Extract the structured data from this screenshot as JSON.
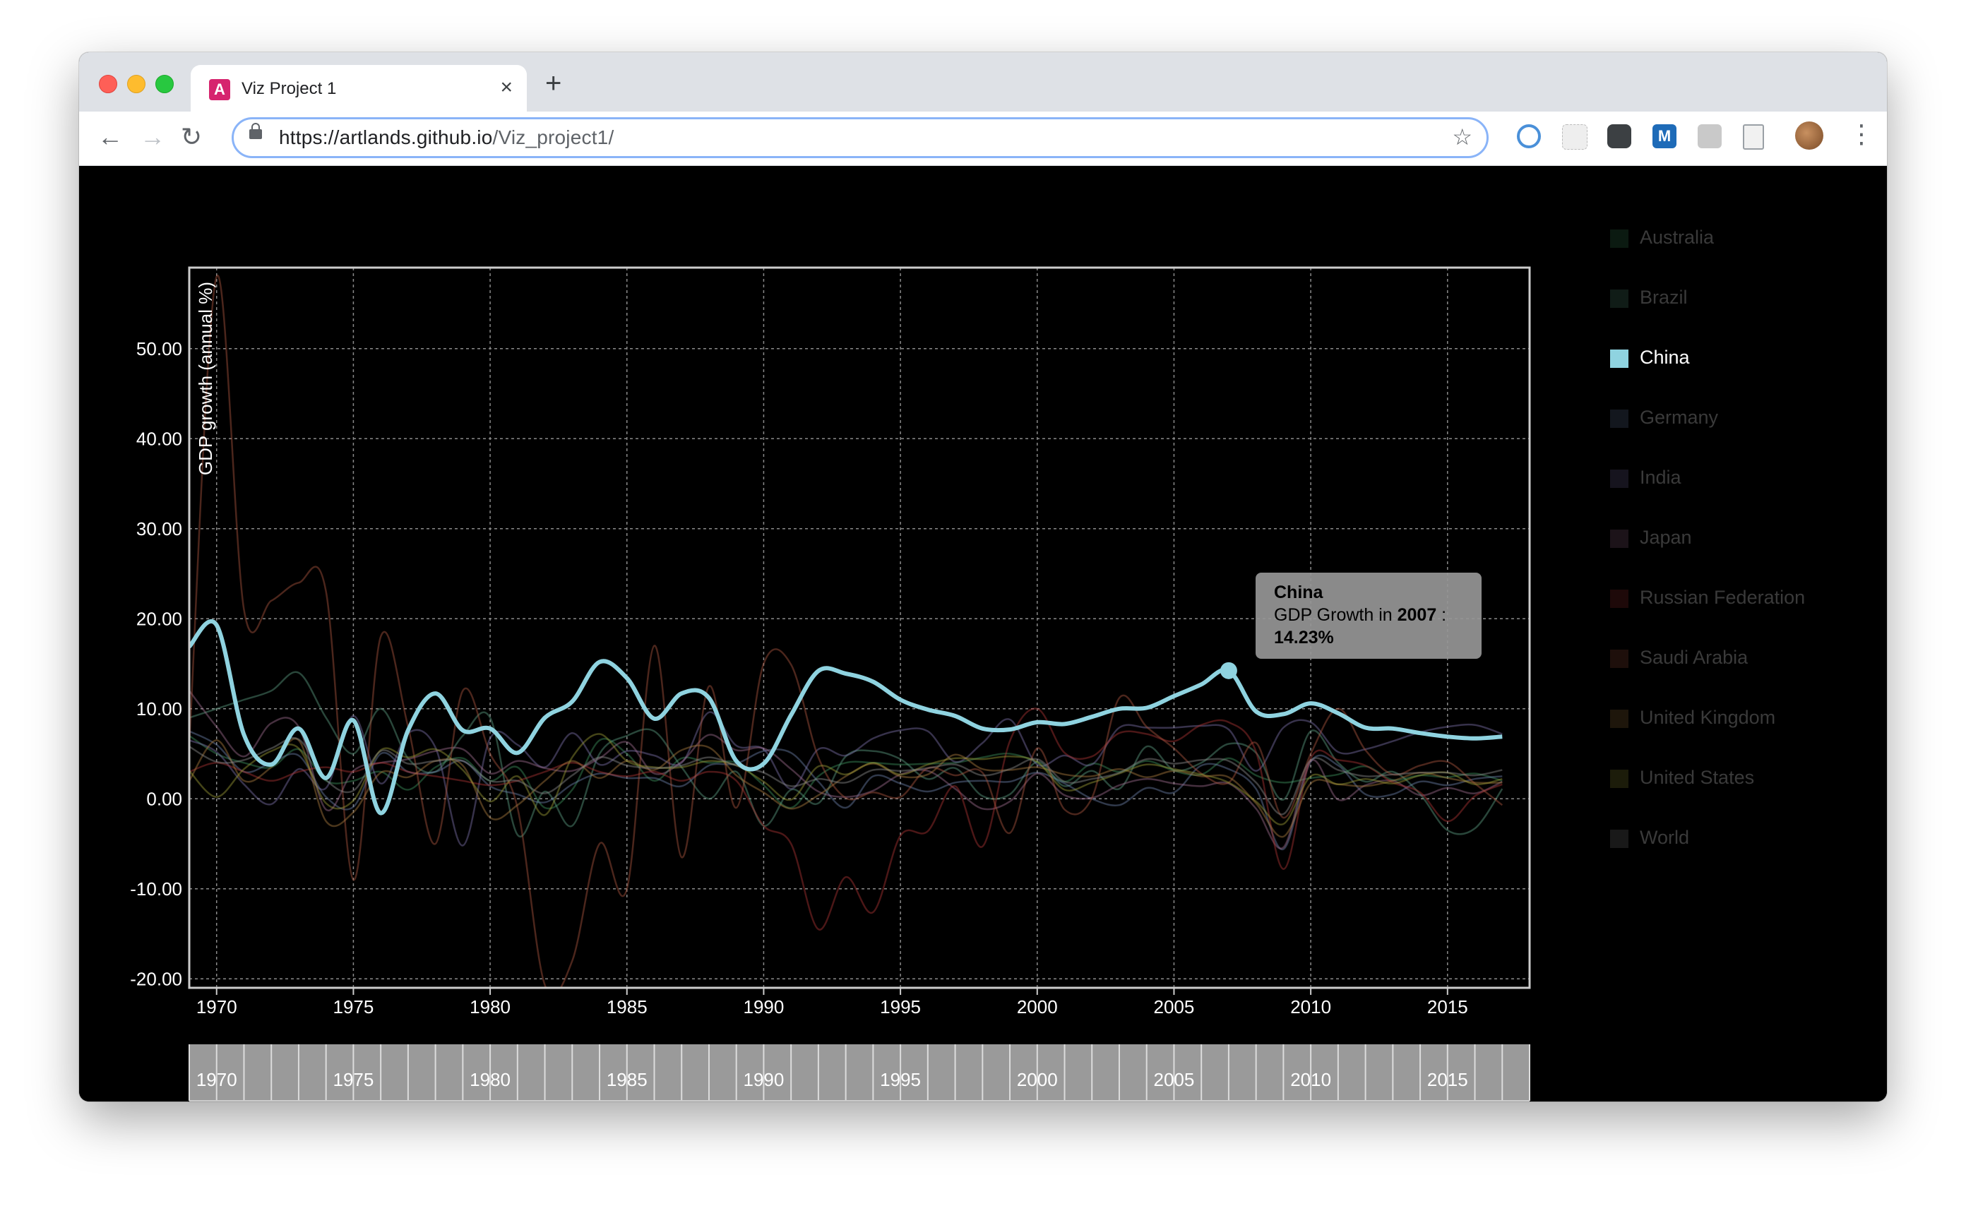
{
  "browser": {
    "tab_title": "Viz Project 1",
    "favicon_letter": "A",
    "url_host": "https://artlands.github.io",
    "url_path": "/Viz_project1/",
    "extension_m_label": "M"
  },
  "tooltip": {
    "country": "China",
    "prefix": "GDP Growth in ",
    "year": "2007",
    "separator": " :",
    "value": "14.23%"
  },
  "legend": [
    {
      "name": "Australia",
      "color": "#3b8f5c",
      "active": false
    },
    {
      "name": "Brazil",
      "color": "#5b9c80",
      "active": false
    },
    {
      "name": "China",
      "color": "#8fd3e0",
      "active": true
    },
    {
      "name": "Germany",
      "color": "#6a7fa6",
      "active": false
    },
    {
      "name": "India",
      "color": "#7a6fa6",
      "active": false
    },
    {
      "name": "Japan",
      "color": "#9c6a8c",
      "active": false
    },
    {
      "name": "Russian Federation",
      "color": "#a83232",
      "active": false
    },
    {
      "name": "Saudi Arabia",
      "color": "#a8553f",
      "active": false
    },
    {
      "name": "United Kingdom",
      "color": "#a8793f",
      "active": false
    },
    {
      "name": "United States",
      "color": "#9a9a35",
      "active": false
    },
    {
      "name": "World",
      "color": "#8a8a8a",
      "active": false
    }
  ],
  "chart_data": {
    "type": "line",
    "title": "",
    "xlabel": "",
    "ylabel": "GDP growth (annual %)",
    "xlim": [
      1969,
      2018
    ],
    "ylim": [
      -21,
      59
    ],
    "x_ticks": [
      1970,
      1975,
      1980,
      1985,
      1990,
      1995,
      2000,
      2005,
      2010,
      2015
    ],
    "y_ticks": [
      "50.00",
      "40.00",
      "30.00",
      "20.00",
      "10.00",
      "0.00",
      "-10.00",
      "-20.00"
    ],
    "grid": true,
    "highlight": {
      "series": "China",
      "x": 2007,
      "y": 14.23
    },
    "brush_x_ticks": [
      1970,
      1975,
      1980,
      1985,
      1990,
      1995,
      2000,
      2005,
      2010,
      2015
    ],
    "x": [
      1969,
      1970,
      1971,
      1972,
      1973,
      1974,
      1975,
      1976,
      1977,
      1978,
      1979,
      1980,
      1981,
      1982,
      1983,
      1984,
      1985,
      1986,
      1987,
      1988,
      1989,
      1990,
      1991,
      1992,
      1993,
      1994,
      1995,
      1996,
      1997,
      1998,
      1999,
      2000,
      2001,
      2002,
      2003,
      2004,
      2005,
      2006,
      2007,
      2008,
      2009,
      2010,
      2011,
      2012,
      2013,
      2014,
      2015,
      2016,
      2017
    ],
    "series": [
      {
        "name": "Australia",
        "values": [
          7.0,
          5.0,
          4.0,
          3.5,
          5.5,
          2.0,
          2.0,
          3.0,
          1.0,
          3.5,
          4.5,
          2.0,
          3.5,
          -1.0,
          1.0,
          6.5,
          5.0,
          2.0,
          4.5,
          4.0,
          4.0,
          1.5,
          -1.0,
          2.5,
          4.0,
          4.0,
          3.8,
          3.9,
          4.0,
          4.6,
          5.0,
          4.0,
          1.9,
          3.9,
          3.0,
          4.2,
          3.1,
          2.7,
          4.5,
          2.6,
          1.8,
          2.3,
          2.7,
          3.6,
          2.1,
          2.6,
          2.4,
          2.8,
          2.0
        ]
      },
      {
        "name": "Brazil",
        "values": [
          9.0,
          10.0,
          11.0,
          12.0,
          14.0,
          9.0,
          5.0,
          10.0,
          4.5,
          3.0,
          7.0,
          9.0,
          -4.0,
          0.8,
          -3.0,
          5.0,
          7.0,
          7.5,
          3.5,
          0.0,
          3.0,
          -3.0,
          1.0,
          -0.5,
          4.7,
          5.3,
          4.4,
          2.2,
          3.4,
          0.3,
          0.5,
          4.1,
          1.4,
          3.1,
          1.1,
          5.8,
          3.2,
          4.0,
          6.1,
          5.1,
          -0.1,
          7.5,
          4.0,
          1.9,
          3.0,
          0.5,
          -3.5,
          -3.3,
          1.1
        ]
      },
      {
        "name": "China",
        "values": [
          16.9,
          19.3,
          7.1,
          3.8,
          7.8,
          2.3,
          8.7,
          -1.6,
          7.6,
          11.7,
          7.6,
          7.8,
          5.1,
          9.0,
          10.8,
          15.2,
          13.4,
          8.9,
          11.7,
          11.2,
          4.2,
          3.9,
          9.3,
          14.2,
          13.9,
          13.0,
          11.0,
          9.9,
          9.2,
          7.8,
          7.7,
          8.5,
          8.3,
          9.1,
          10.0,
          10.1,
          11.4,
          12.7,
          14.23,
          9.7,
          9.4,
          10.6,
          9.5,
          7.9,
          7.8,
          7.3,
          6.9,
          6.7,
          6.9
        ]
      },
      {
        "name": "Germany",
        "values": [
          7.5,
          6.0,
          3.0,
          4.0,
          4.8,
          0.2,
          -0.9,
          5.0,
          3.0,
          3.0,
          4.2,
          1.4,
          0.5,
          -0.4,
          1.6,
          2.8,
          2.3,
          2.3,
          1.4,
          3.7,
          3.9,
          5.3,
          5.1,
          1.9,
          -1.0,
          2.5,
          1.7,
          0.8,
          1.8,
          2.0,
          1.9,
          2.9,
          1.7,
          0.0,
          -0.7,
          1.2,
          0.7,
          3.7,
          3.3,
          1.1,
          -5.6,
          4.1,
          3.7,
          0.5,
          0.5,
          1.9,
          1.5,
          2.2,
          2.5
        ]
      },
      {
        "name": "India",
        "values": [
          6.5,
          5.2,
          1.6,
          -0.6,
          3.3,
          1.2,
          9.2,
          1.7,
          7.3,
          5.7,
          -5.2,
          6.7,
          6.0,
          3.5,
          7.3,
          3.8,
          5.3,
          4.8,
          4.0,
          9.6,
          5.9,
          5.5,
          1.1,
          5.5,
          4.8,
          6.7,
          7.6,
          7.5,
          4.1,
          6.2,
          8.8,
          3.8,
          4.8,
          3.8,
          7.9,
          7.9,
          7.9,
          8.1,
          7.7,
          3.1,
          7.9,
          8.5,
          5.2,
          5.5,
          6.4,
          7.4,
          8.0,
          8.2,
          7.2
        ]
      },
      {
        "name": "Japan",
        "values": [
          12.0,
          8.0,
          4.7,
          8.4,
          8.0,
          -1.2,
          3.1,
          4.0,
          4.4,
          5.3,
          5.5,
          2.8,
          4.2,
          3.4,
          3.1,
          4.5,
          6.3,
          2.8,
          4.1,
          7.1,
          5.4,
          5.6,
          3.3,
          0.8,
          0.2,
          0.9,
          2.7,
          3.1,
          1.1,
          -1.1,
          -0.3,
          2.8,
          0.4,
          0.1,
          1.5,
          2.2,
          1.7,
          1.4,
          1.7,
          -1.1,
          -5.4,
          4.2,
          -0.1,
          1.5,
          2.0,
          0.4,
          1.2,
          0.6,
          1.9
        ]
      },
      {
        "name": "Russian Federation",
        "values": [
          3.0,
          4.0,
          3.0,
          2.0,
          3.0,
          3.5,
          3.0,
          4.0,
          3.0,
          2.5,
          2.0,
          1.5,
          2.0,
          3.0,
          4.0,
          3.0,
          2.5,
          3.0,
          2.0,
          3.0,
          2.0,
          -3.0,
          -5.0,
          -14.5,
          -8.7,
          -12.6,
          -4.1,
          -3.6,
          1.4,
          -5.3,
          6.4,
          10.0,
          5.1,
          4.7,
          7.3,
          7.2,
          6.4,
          8.2,
          8.5,
          5.2,
          -7.8,
          4.5,
          4.3,
          3.7,
          1.8,
          0.7,
          -2.5,
          0.3,
          1.6
        ]
      },
      {
        "name": "Saudi Arabia",
        "values": [
          6.0,
          58.0,
          21.0,
          22.0,
          24.0,
          23.0,
          -9.0,
          18.0,
          8.0,
          -5.0,
          12.0,
          5.0,
          -1.0,
          -20.7,
          -18.0,
          -5.0,
          -10.0,
          17.0,
          -6.5,
          12.5,
          -1.0,
          15.0,
          14.9,
          4.6,
          0.1,
          0.7,
          0.2,
          3.4,
          2.6,
          2.9,
          -3.8,
          5.6,
          -1.2,
          0.1,
          11.2,
          8.0,
          5.6,
          2.8,
          1.8,
          6.2,
          -2.1,
          5.0,
          10.0,
          5.4,
          2.7,
          3.7,
          4.1,
          1.7,
          -0.7
        ]
      },
      {
        "name": "United Kingdom",
        "values": [
          2.0,
          6.5,
          2.0,
          3.5,
          6.5,
          -2.5,
          -1.5,
          2.9,
          2.4,
          4.2,
          3.7,
          -2.1,
          -0.7,
          2.0,
          4.2,
          2.3,
          4.2,
          3.2,
          5.4,
          5.7,
          2.6,
          0.7,
          -1.1,
          0.4,
          2.5,
          3.9,
          2.5,
          2.7,
          4.9,
          3.3,
          3.2,
          3.5,
          2.7,
          2.5,
          3.3,
          2.4,
          3.1,
          2.5,
          2.4,
          -0.5,
          -4.2,
          1.7,
          1.6,
          1.4,
          2.0,
          2.9,
          2.3,
          1.8,
          1.8
        ]
      },
      {
        "name": "United States",
        "values": [
          3.1,
          0.2,
          3.3,
          5.3,
          5.6,
          -0.5,
          -0.2,
          5.4,
          4.6,
          5.5,
          3.2,
          -0.3,
          2.5,
          -1.8,
          4.6,
          7.2,
          4.2,
          3.5,
          3.5,
          4.2,
          3.7,
          1.9,
          -0.1,
          3.6,
          2.7,
          4.0,
          2.7,
          3.8,
          4.5,
          4.4,
          4.7,
          4.1,
          1.0,
          1.8,
          2.8,
          3.8,
          3.3,
          2.7,
          1.8,
          -0.3,
          -2.8,
          2.5,
          1.6,
          2.2,
          1.7,
          2.6,
          2.9,
          1.6,
          2.2
        ]
      },
      {
        "name": "World",
        "values": [
          5.8,
          4.1,
          4.3,
          5.6,
          6.6,
          2.1,
          0.9,
          5.3,
          3.9,
          4.2,
          4.2,
          2.0,
          2.0,
          0.6,
          2.6,
          4.6,
          3.7,
          3.4,
          3.7,
          4.6,
          3.7,
          2.9,
          1.4,
          2.2,
          1.8,
          3.2,
          3.1,
          3.4,
          3.8,
          2.6,
          3.3,
          4.4,
          1.9,
          2.2,
          2.9,
          4.4,
          3.9,
          4.3,
          4.2,
          1.8,
          -1.7,
          4.3,
          3.2,
          2.5,
          2.7,
          2.9,
          2.9,
          2.6,
          3.2
        ]
      }
    ]
  }
}
